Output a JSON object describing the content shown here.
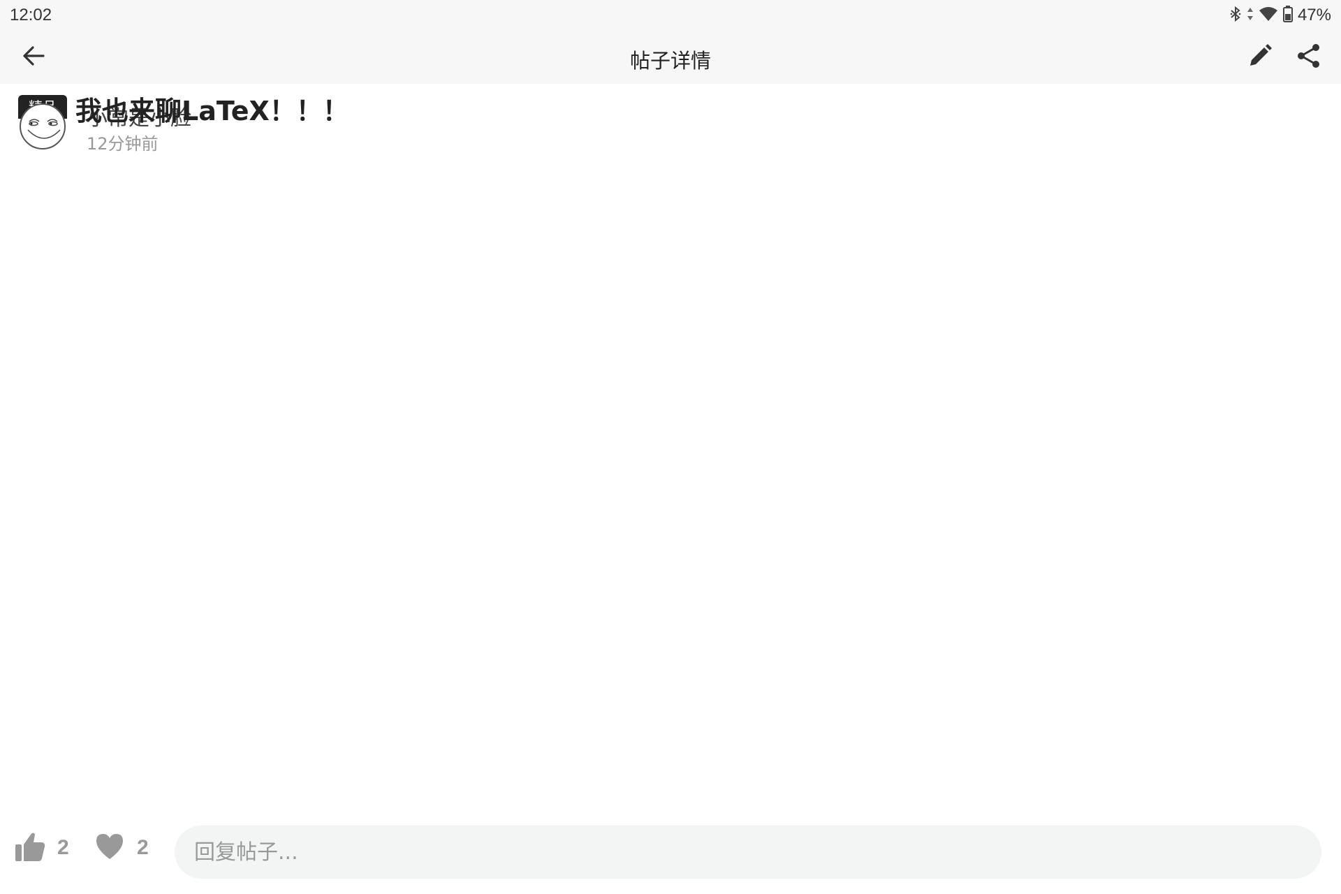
{
  "status_bar": {
    "time": "12:02",
    "battery_text": "47%",
    "icons": [
      "bluetooth-icon",
      "data-arrows-icon",
      "wifi-icon",
      "battery-icon"
    ]
  },
  "app_bar": {
    "title": "帖子详情",
    "icons": [
      "back-arrow-icon",
      "edit-pencil-icon",
      "share-icon"
    ]
  },
  "post": {
    "badge": "精品",
    "title": "我也来聊LaTeX！！！",
    "author": "小常是小脸",
    "time": "12分钟前"
  },
  "bottom_bar": {
    "like_count": "2",
    "favorite_count": "2",
    "reply_placeholder": "回复帖子..."
  },
  "colors": {
    "bar_background": "#f7f7f7",
    "input_background": "#f3f4f4",
    "muted_text": "#999999",
    "title_text": "#222222"
  }
}
